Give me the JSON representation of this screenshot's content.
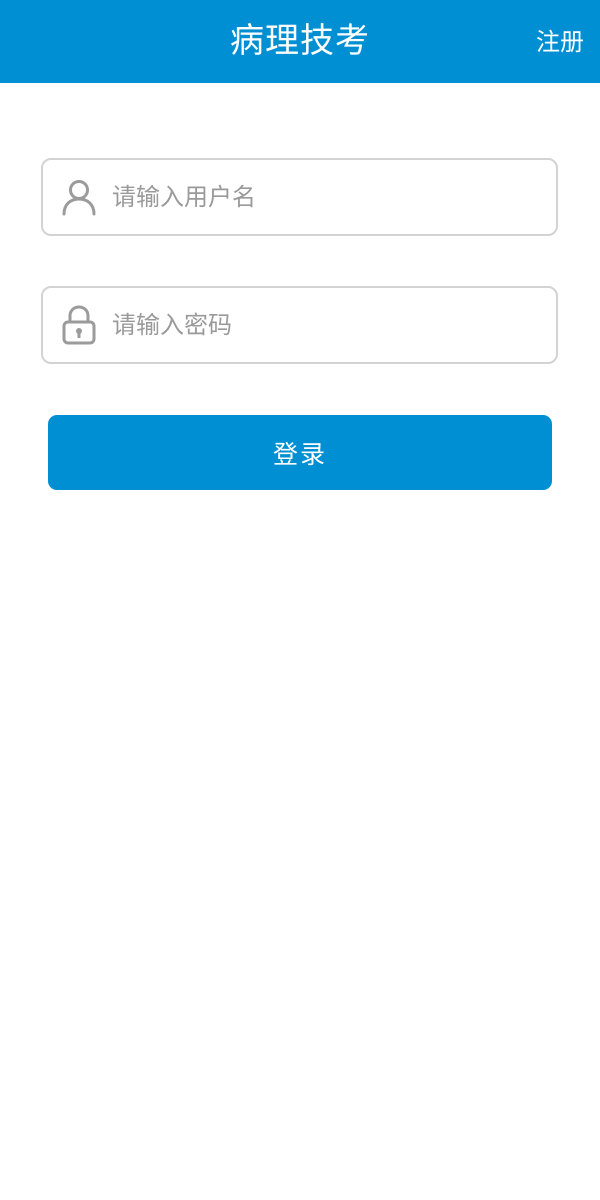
{
  "header": {
    "title": "病理技考",
    "action_label": "注册"
  },
  "login_form": {
    "username": {
      "icon": "user-icon",
      "value": "",
      "placeholder": "请输入用户名"
    },
    "password": {
      "icon": "lock-icon",
      "value": "",
      "placeholder": "请输入密码"
    },
    "submit_label": "登录"
  },
  "colors": {
    "primary": "#008fd2",
    "field_border": "#d3d3d3",
    "placeholder_text": "#9a9a9a",
    "icon": "#9b9b9b",
    "background": "#ffffff"
  }
}
